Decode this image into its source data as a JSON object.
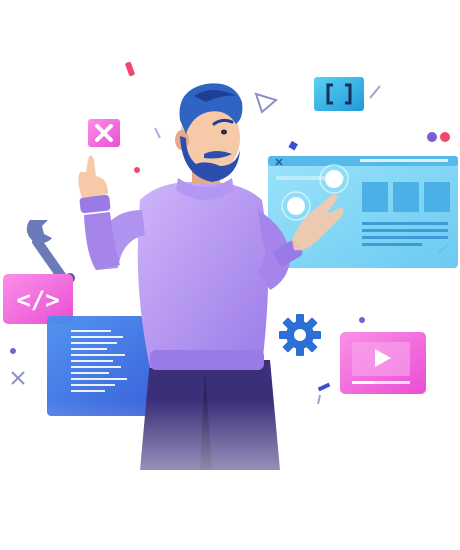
{
  "illustration": {
    "subject": "developer-interacting-with-holographic-ui",
    "palette": {
      "background": "#ffffff",
      "sweater_light": "#c3a6f6",
      "sweater_mid": "#a888ee",
      "sweater_dark": "#8b6ae0",
      "pants": "#3b2f7a",
      "skin": "#f6c9a8",
      "skin_shadow": "#e9a988",
      "hair": "#2f63c4",
      "hair_dark": "#1f3f93",
      "beard": "#2a4fae",
      "panel_cyan": "#7fd8f6",
      "panel_cyan_dark": "#38b3e6",
      "panel_blue": "#3d7be6",
      "panel_blue_dark": "#2b4fd0",
      "pink": "#f04fd0",
      "pink_light": "#f98be6",
      "wrench": "#6b7bb8",
      "gear": "#2c6fd6",
      "accent_red": "#f2476d",
      "accent_purple": "#7e5bd8"
    },
    "icons": {
      "close_card": "close-icon",
      "code_card": "code-tag-icon",
      "bracket_card": "brackets-icon",
      "video_card": "play-icon",
      "gear": "gear-icon",
      "wrench": "wrench-icon"
    }
  }
}
